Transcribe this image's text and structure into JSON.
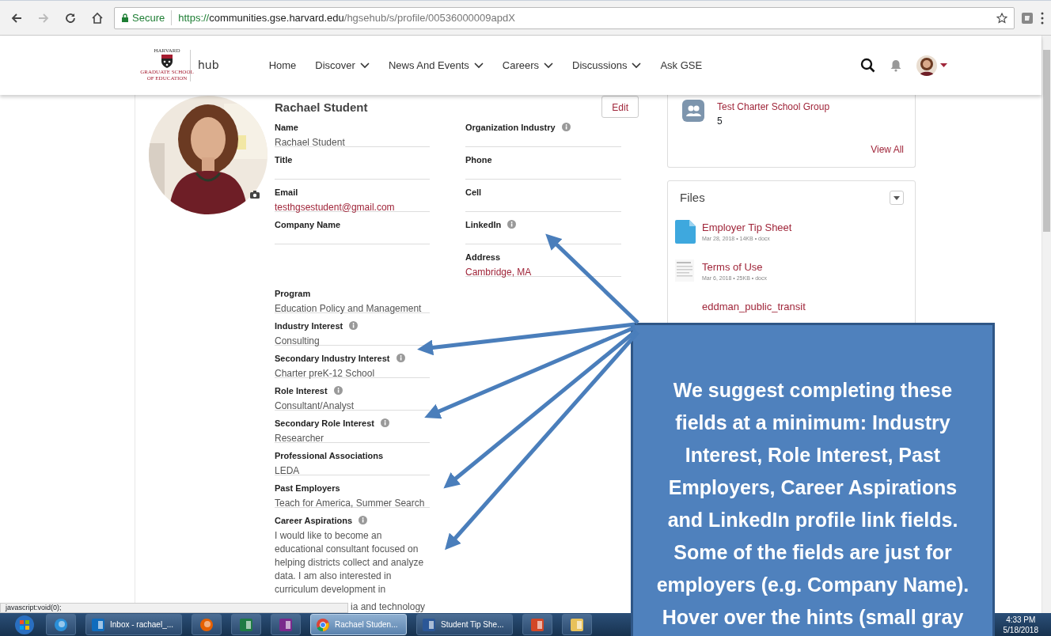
{
  "browser": {
    "nav_buttons": [
      {
        "kind": "back",
        "disabled": false
      },
      {
        "kind": "forward",
        "disabled": true
      },
      {
        "kind": "reload",
        "disabled": false
      },
      {
        "kind": "home",
        "disabled": false
      }
    ],
    "secure_label": "Secure",
    "url": {
      "scheme": "https://",
      "host": "communities.gse.harvard.edu",
      "path": "/hgsehub/s/profile/00536000009apdX"
    }
  },
  "site_header": {
    "logo": {
      "top_text": "HARVARD",
      "bottom_text": "GRADUATE SCHOOL OF EDUCATION"
    },
    "brand": "hub",
    "nav": [
      {
        "label": "Home",
        "has_menu": false
      },
      {
        "label": "Discover",
        "has_menu": true
      },
      {
        "label": "News And Events",
        "has_menu": true
      },
      {
        "label": "Careers",
        "has_menu": true
      },
      {
        "label": "Discussions",
        "has_menu": true
      },
      {
        "label": "Ask GSE",
        "has_menu": false
      }
    ]
  },
  "profile": {
    "name": "Rachael Student",
    "edit_button": "Edit",
    "fields_left": [
      {
        "label": "Name",
        "value": "Rachael Student",
        "link": false,
        "hint": false
      },
      {
        "label": "Title",
        "hint": false
      },
      {
        "label": "Email",
        "value": "testhgsestudent@gmail.com",
        "link": true,
        "hint": false
      },
      {
        "label": "Company Name",
        "hint": false
      }
    ],
    "fields_right": [
      {
        "label": "Organization Industry",
        "hint": true
      },
      {
        "label": "Phone",
        "hint": false
      },
      {
        "label": "Cell",
        "hint": false
      },
      {
        "label": "LinkedIn",
        "hint": true
      },
      {
        "label": "Address",
        "value": "Cambridge, MA",
        "link": true,
        "hint": false
      }
    ],
    "fields_more": [
      {
        "label": "Program",
        "value": "Education Policy and Management",
        "link": false,
        "hint": false
      },
      {
        "label": "Industry Interest",
        "value": "Consulting",
        "link": false,
        "hint": true
      },
      {
        "label": "Secondary Industry Interest",
        "value": "Charter preK-12 School",
        "link": false,
        "hint": true
      },
      {
        "label": "Role Interest",
        "value": "Consultant/Analyst",
        "link": false,
        "hint": true
      },
      {
        "label": "Secondary Role Interest",
        "value": "Researcher",
        "link": false,
        "hint": true
      },
      {
        "label": "Professional Associations",
        "value": "LEDA",
        "link": false,
        "hint": false
      },
      {
        "label": "Past Employers",
        "value": "Teach for America, Summer Search",
        "link": false,
        "hint": false
      },
      {
        "label": "Career Aspirations",
        "value": "I would like to become an educational consultant focused on helping districts collect and analyze data. I am also interested in curriculum development in",
        "value_tail": "ia and technology",
        "link": false,
        "hint": true
      }
    ]
  },
  "groups_card": {
    "group": {
      "name": "Test Charter School Group",
      "count": "5"
    },
    "view_all": "View All"
  },
  "files_card": {
    "title": "Files",
    "files": [
      {
        "name": "Employer Tip Sheet",
        "details": "Mar 28, 2018 • 14KB • docx",
        "kind": "doc"
      },
      {
        "name": "Terms of Use",
        "details": "Mar 6, 2018 • 25KB • docx",
        "kind": "thumb"
      },
      {
        "name": "eddman_public_transit",
        "kind": "partial"
      }
    ]
  },
  "callout": {
    "text": "We suggest completing these fields at a minimum: Industry Interest, Role Interest, Past Employers, Career Aspirations and LinkedIn profile link fields. Some of the fields are just for employers (e.g. Company Name). Hover over the hints (small gray"
  },
  "status_bar": "javascript:void(0);",
  "taskbar": {
    "items": [
      {
        "kind": "ie",
        "selected": false
      },
      {
        "kind": "outlook",
        "label": "Inbox - rachael_...",
        "selected": false
      },
      {
        "kind": "firefox",
        "selected": false
      },
      {
        "kind": "excel",
        "selected": false
      },
      {
        "kind": "onenote",
        "selected": false
      },
      {
        "kind": "chrome",
        "label": "Rachael Studen...",
        "selected": true
      },
      {
        "kind": "word",
        "label": "Student Tip She...",
        "selected": false
      },
      {
        "kind": "powerpoint",
        "selected": false
      },
      {
        "kind": "folder",
        "selected": false
      }
    ],
    "time": "4:33 PM",
    "date": "5/18/2018"
  }
}
